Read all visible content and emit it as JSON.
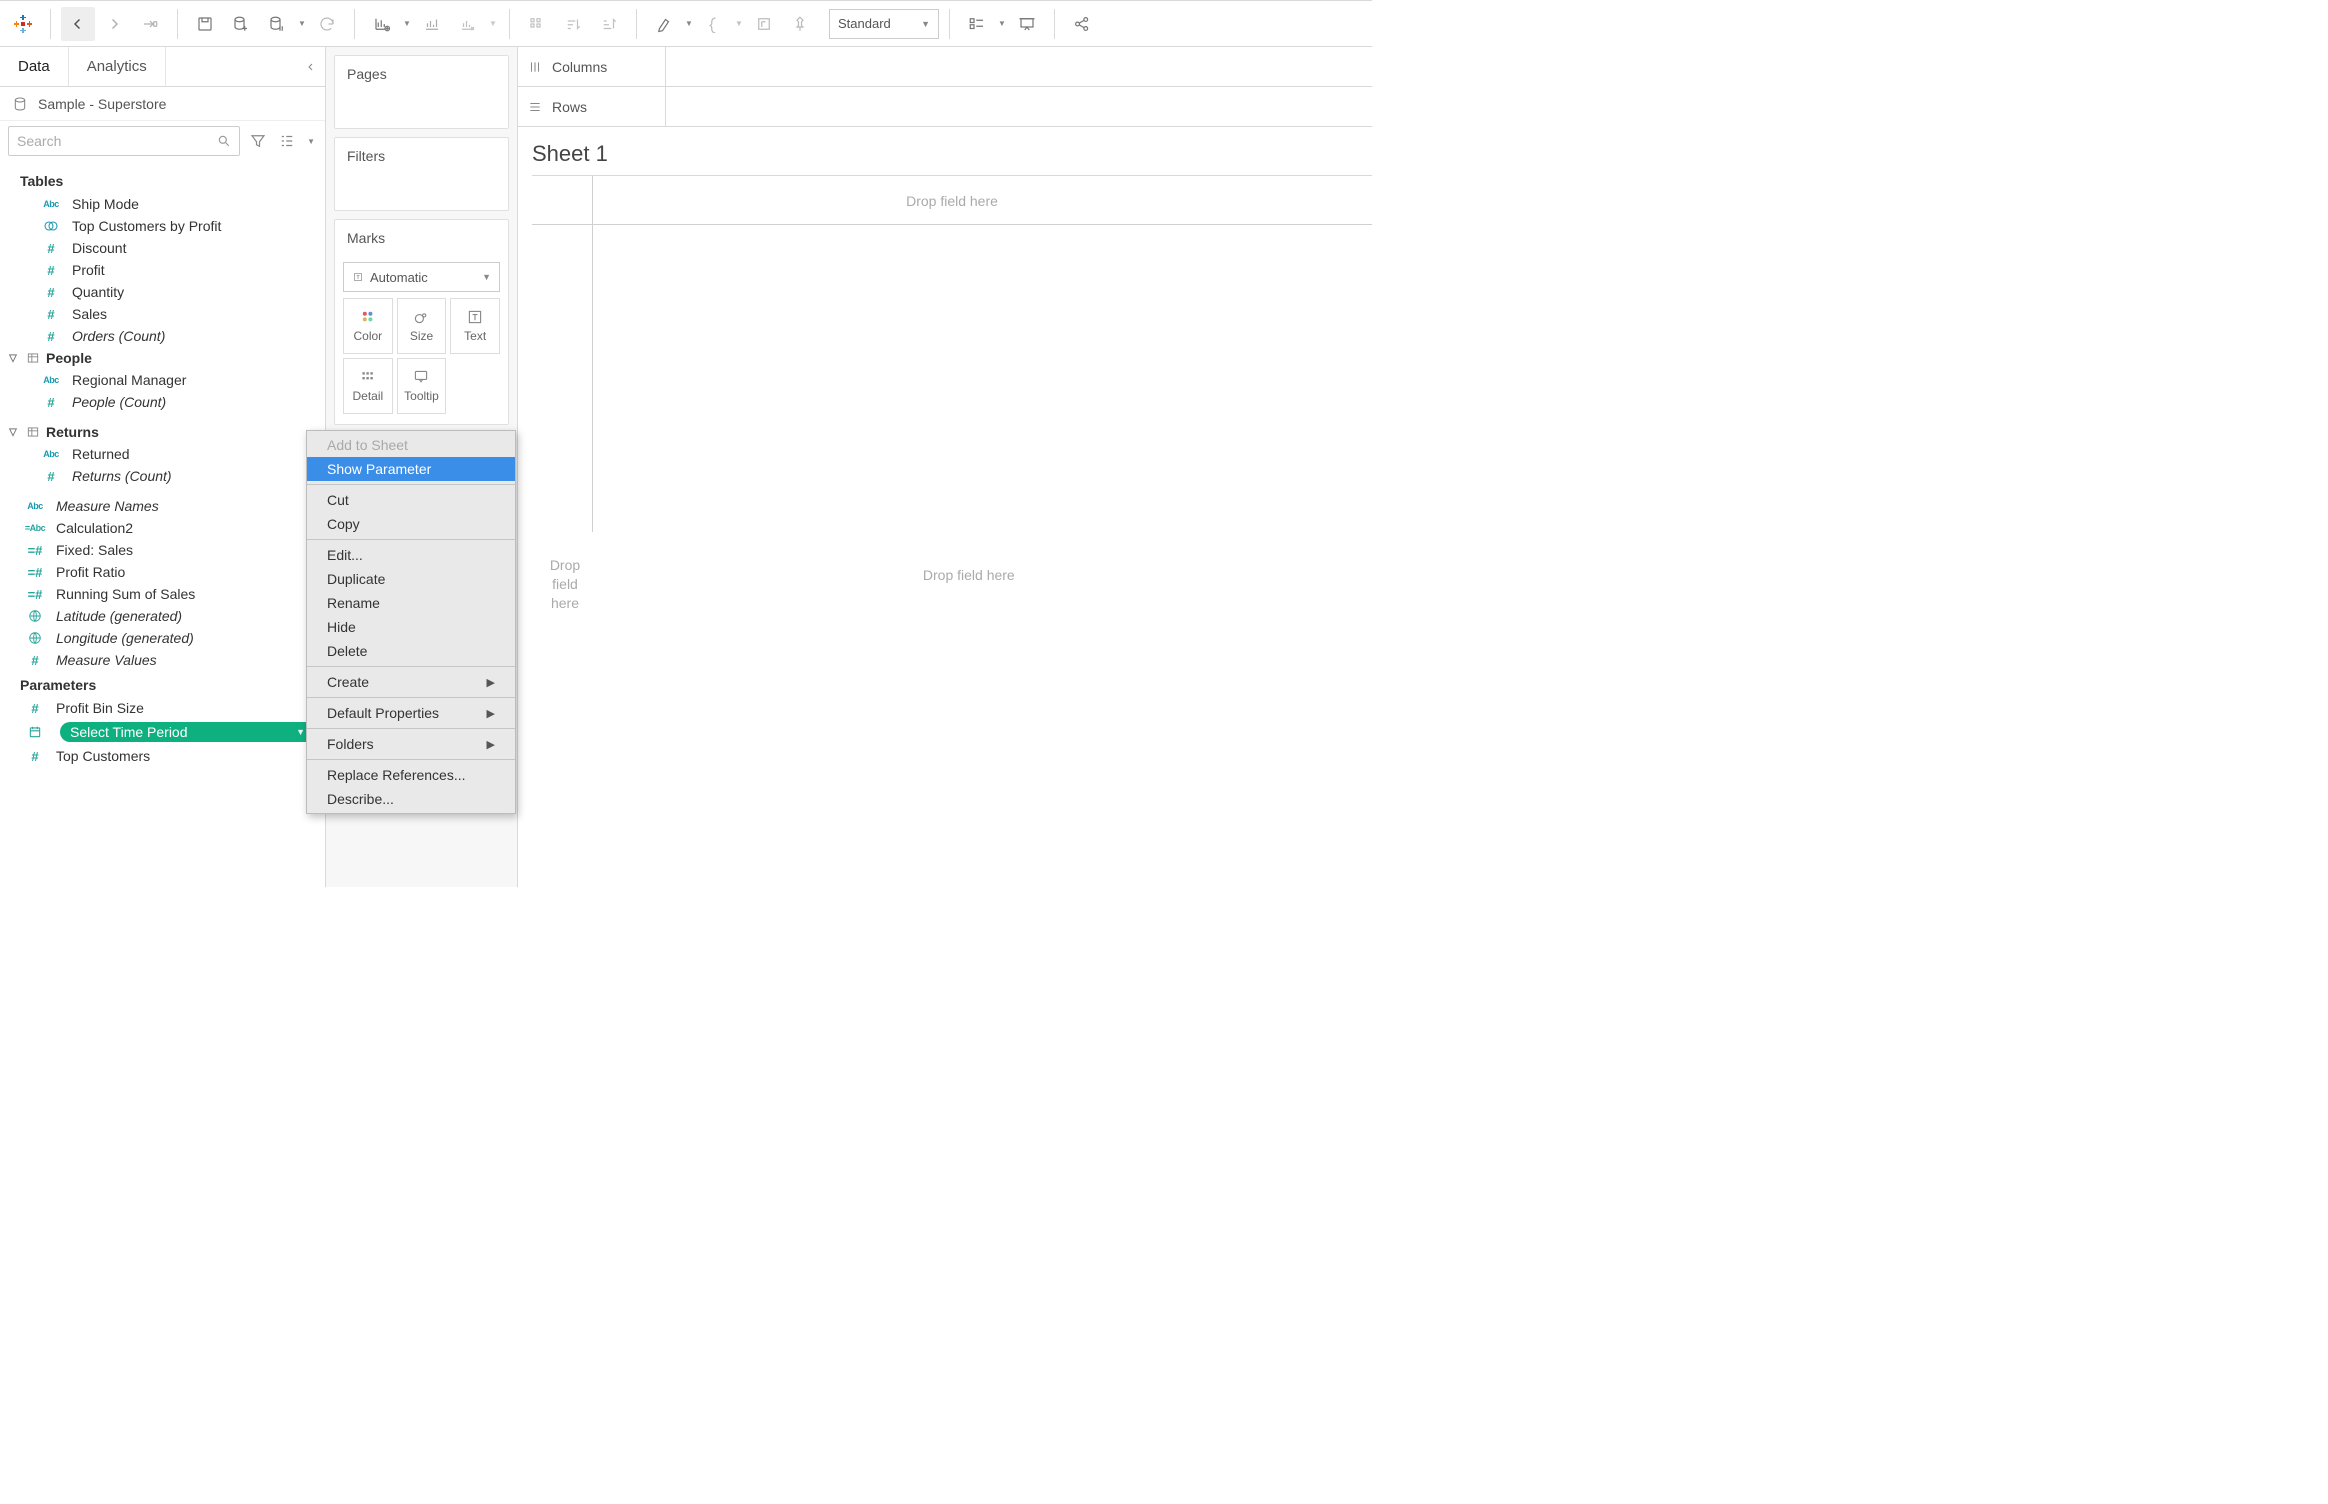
{
  "toolbar": {
    "fit_label": "Standard"
  },
  "datapane": {
    "tab_data": "Data",
    "tab_analytics": "Analytics",
    "datasource": "Sample - Superstore",
    "search_placeholder": "Search",
    "tables_header": "Tables",
    "tables_flat": [
      {
        "icon": "abc",
        "label": "Ship Mode"
      },
      {
        "icon": "set",
        "label": "Top Customers by Profit"
      },
      {
        "icon": "hashm",
        "label": "Discount"
      },
      {
        "icon": "hashm",
        "label": "Profit"
      },
      {
        "icon": "hashm",
        "label": "Quantity"
      },
      {
        "icon": "hashm",
        "label": "Sales"
      },
      {
        "icon": "hashm",
        "label": "Orders (Count)",
        "italic": true
      }
    ],
    "group_people": "People",
    "people_items": [
      {
        "icon": "abc",
        "label": "Regional Manager"
      },
      {
        "icon": "hashm",
        "label": "People (Count)",
        "italic": true
      }
    ],
    "group_returns": "Returns",
    "returns_items": [
      {
        "icon": "abc",
        "label": "Returned"
      },
      {
        "icon": "hashm",
        "label": "Returns (Count)",
        "italic": true
      }
    ],
    "loose_items": [
      {
        "icon": "abc",
        "label": "Measure Names",
        "italic": true
      },
      {
        "icon": "calc",
        "label": "Calculation2"
      },
      {
        "icon": "calchash",
        "label": "Fixed: Sales"
      },
      {
        "icon": "calchash",
        "label": "Profit Ratio"
      },
      {
        "icon": "calchash",
        "label": "Running Sum of Sales"
      },
      {
        "icon": "geo",
        "label": "Latitude (generated)",
        "italic": true
      },
      {
        "icon": "geo",
        "label": "Longitude (generated)",
        "italic": true
      },
      {
        "icon": "hashm",
        "label": "Measure Values",
        "italic": true
      }
    ],
    "parameters_header": "Parameters",
    "parameters": [
      {
        "icon": "hashm",
        "label": "Profit Bin Size"
      },
      {
        "icon": "date",
        "label": "Select Time Period",
        "selected": true
      },
      {
        "icon": "hashm",
        "label": "Top Customers"
      }
    ]
  },
  "cards": {
    "pages": "Pages",
    "filters": "Filters",
    "marks": "Marks",
    "marks_type": "Automatic",
    "mark_color": "Color",
    "mark_size": "Size",
    "mark_text": "Text",
    "mark_detail": "Detail",
    "mark_tooltip": "Tooltip"
  },
  "shelves": {
    "columns": "Columns",
    "rows": "Rows"
  },
  "sheet": {
    "title": "Sheet 1",
    "drop_here_1": "Drop field here",
    "drop_vert": "Drop\nfield\nhere",
    "drop_here_2": "Drop field here"
  },
  "context_menu": {
    "items": [
      {
        "label": "Add to Sheet",
        "disabled": true
      },
      {
        "label": "Show Parameter",
        "hover": true
      },
      {
        "sep": true
      },
      {
        "label": "Cut"
      },
      {
        "label": "Copy"
      },
      {
        "sep": true
      },
      {
        "label": "Edit..."
      },
      {
        "label": "Duplicate"
      },
      {
        "label": "Rename"
      },
      {
        "label": "Hide"
      },
      {
        "label": "Delete"
      },
      {
        "sep": true
      },
      {
        "label": "Create",
        "sub": true
      },
      {
        "sep": true
      },
      {
        "label": "Default Properties",
        "sub": true
      },
      {
        "sep": true
      },
      {
        "label": "Folders",
        "sub": true
      },
      {
        "sep": true
      },
      {
        "label": "Replace References..."
      },
      {
        "label": "Describe..."
      }
    ]
  }
}
